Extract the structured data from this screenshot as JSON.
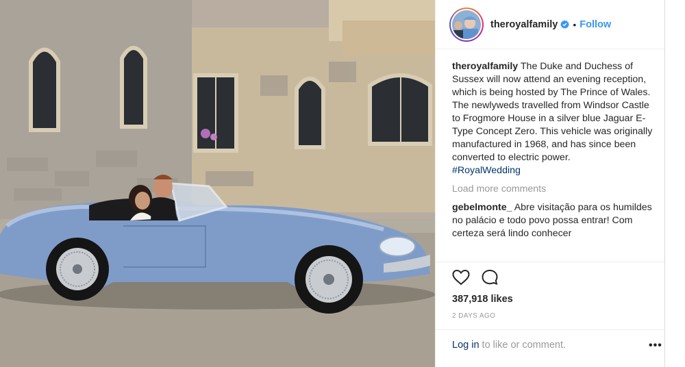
{
  "post": {
    "username": "theroyalfamily",
    "follow_label": "Follow",
    "dot": "•",
    "caption": {
      "username": "theroyalfamily",
      "paragraph1": "The Duke and Duchess of Sussex will now attend an evening reception, which is being hosted by The Prince of Wales.",
      "paragraph2": "The newlyweds travelled from Windsor Castle to Frogmore House in a silver blue Jaguar E-Type Concept Zero. This vehicle was originally manufactured in 1968, and has since been converted to electric power.",
      "hashtag": "#RoyalWedding"
    },
    "load_more_label": "Load more comments",
    "comment": {
      "username": "gebelmonte_",
      "text": "Abre visitação para os humildes no palácio e todo povo possa entrar! Com certeza será lindo conhecer"
    },
    "likes": "387,918 likes",
    "date": "2 DAYS AGO",
    "login_link": "Log in",
    "login_rest": " to like or comment.",
    "more_label": "•••"
  },
  "icons": {
    "like": "heart-icon",
    "comment": "comment-icon",
    "verified": "verified-badge-icon"
  },
  "colors": {
    "link_blue": "#3897f0",
    "hashtag": "#003569",
    "muted": "#999999",
    "car_blue": "#7f9cc9"
  }
}
